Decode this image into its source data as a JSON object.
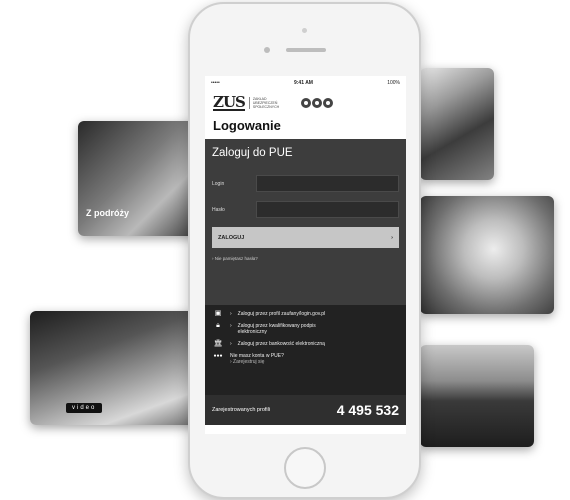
{
  "status": {
    "carrier": "•••••",
    "time": "9:41 AM",
    "battery": "100%"
  },
  "brand": {
    "logo": "ZUS",
    "org_line1": "ZAKŁAD",
    "org_line2": "UBEZPIECZEŃ",
    "org_line3": "SPOŁECZNYCH"
  },
  "page_title": "Logowanie",
  "login": {
    "title": "Zaloguj do PUE",
    "login_label": "Login",
    "password_label": "Hasło",
    "submit_label": "ZALOGUJ",
    "submit_arrow": "›",
    "forgot": "› Nie pamiętasz hasła?"
  },
  "alternatives": [
    {
      "icon": "profile-trusted-icon",
      "glyph": "▣",
      "text": "Zaloguj przez profil zaufany/login.gov.pl",
      "sub": ""
    },
    {
      "icon": "lock-icon",
      "glyph": "🔒",
      "text": "Zaloguj przez kwalifikowany podpis",
      "sub": "elektroniczny"
    },
    {
      "icon": "bank-icon",
      "glyph": "🏛",
      "text": "Zaloguj przez bankowość elektroniczną",
      "sub": ""
    },
    {
      "icon": "ooo-icon",
      "glyph": "●●●",
      "text": "Nie masz konta w PUE?",
      "sub": "› Zarejestruj się"
    }
  ],
  "stats": {
    "label": "Zarejestrowanych profili",
    "value": "4 495 532"
  },
  "cards": {
    "left_top_title": "Z podróży",
    "left_top_sub": "",
    "video_badge": "video"
  }
}
